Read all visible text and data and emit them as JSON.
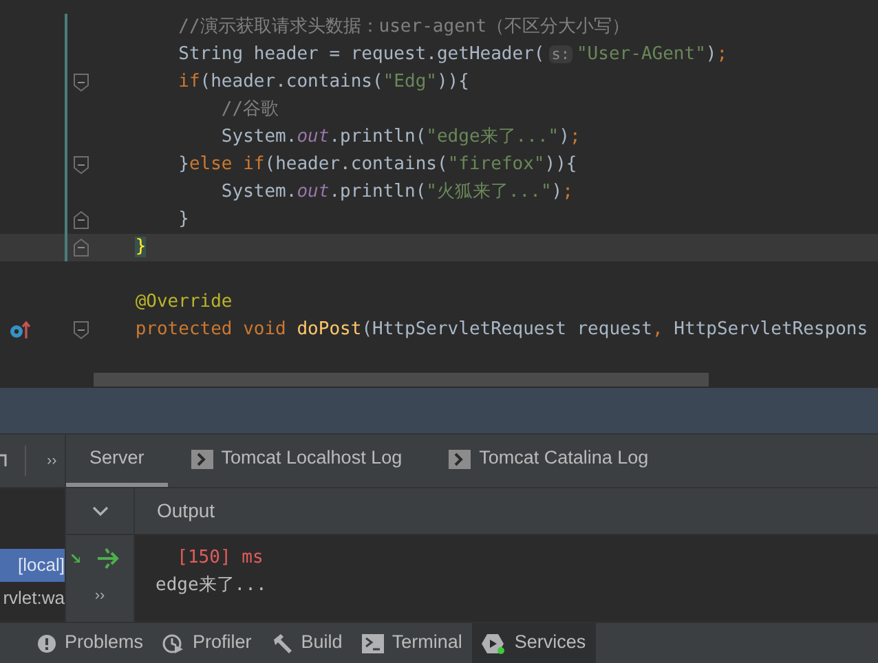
{
  "editor": {
    "lines": [
      {
        "changed": true,
        "current": false,
        "fold_open": false,
        "fold_close": false,
        "override_marker": false,
        "tokens": [
          {
            "kind": "comment",
            "text": "        //演示获取请求头数据：user-agent（不区分大小写）"
          }
        ]
      },
      {
        "changed": true,
        "current": false,
        "fold_open": false,
        "fold_close": false,
        "override_marker": false,
        "tokens": [
          {
            "kind": "plain",
            "text": "        String header = request.getHeader("
          },
          {
            "kind": "hint",
            "text": "s:"
          },
          {
            "kind": "string",
            "text": "\"User-AGent\""
          },
          {
            "kind": "plain",
            "text": ")"
          },
          {
            "kind": "keyword",
            "text": ";"
          }
        ]
      },
      {
        "changed": true,
        "current": false,
        "fold_open": true,
        "fold_close": false,
        "override_marker": false,
        "tokens": [
          {
            "kind": "keyword",
            "text": "        if"
          },
          {
            "kind": "plain",
            "text": "(header.contains("
          },
          {
            "kind": "string",
            "text": "\"Edg\""
          },
          {
            "kind": "plain",
            "text": ")){"
          }
        ]
      },
      {
        "changed": true,
        "current": false,
        "fold_open": false,
        "fold_close": false,
        "override_marker": false,
        "tokens": [
          {
            "kind": "comment",
            "text": "            //谷歌"
          }
        ]
      },
      {
        "changed": true,
        "current": false,
        "fold_open": false,
        "fold_close": false,
        "override_marker": false,
        "tokens": [
          {
            "kind": "plain",
            "text": "            System."
          },
          {
            "kind": "field",
            "text": "out"
          },
          {
            "kind": "plain",
            "text": ".println("
          },
          {
            "kind": "string",
            "text": "\"edge来了...\""
          },
          {
            "kind": "plain",
            "text": ")"
          },
          {
            "kind": "keyword",
            "text": ";"
          }
        ]
      },
      {
        "changed": true,
        "current": false,
        "fold_open": true,
        "fold_close": false,
        "override_marker": false,
        "tokens": [
          {
            "kind": "plain",
            "text": "        }"
          },
          {
            "kind": "keyword",
            "text": "else if"
          },
          {
            "kind": "plain",
            "text": "(header.contains("
          },
          {
            "kind": "string",
            "text": "\"firefox\""
          },
          {
            "kind": "plain",
            "text": ")){"
          }
        ]
      },
      {
        "changed": true,
        "current": false,
        "fold_open": false,
        "fold_close": false,
        "override_marker": false,
        "tokens": [
          {
            "kind": "plain",
            "text": "            System."
          },
          {
            "kind": "field",
            "text": "out"
          },
          {
            "kind": "plain",
            "text": ".println("
          },
          {
            "kind": "string",
            "text": "\"火狐来了...\""
          },
          {
            "kind": "plain",
            "text": ")"
          },
          {
            "kind": "keyword",
            "text": ";"
          }
        ]
      },
      {
        "changed": true,
        "current": false,
        "fold_open": false,
        "fold_close": true,
        "override_marker": false,
        "tokens": [
          {
            "kind": "plain",
            "text": "        }"
          }
        ]
      },
      {
        "changed": true,
        "current": true,
        "fold_open": false,
        "fold_close": true,
        "override_marker": false,
        "tokens": [
          {
            "kind": "brace_match",
            "text": "    }"
          }
        ]
      },
      {
        "changed": false,
        "current": false,
        "fold_open": false,
        "fold_close": false,
        "override_marker": false
      },
      {
        "changed": false,
        "current": false,
        "fold_open": false,
        "fold_close": false,
        "override_marker": false,
        "tokens": [
          {
            "kind": "annotation",
            "text": "    @Override"
          }
        ]
      },
      {
        "changed": false,
        "current": false,
        "fold_open": true,
        "fold_close": false,
        "override_marker": true,
        "tokens": [
          {
            "kind": "keyword",
            "text": "    protected void "
          },
          {
            "kind": "method",
            "text": "doPost"
          },
          {
            "kind": "plain",
            "text": "(HttpServletRequest request"
          },
          {
            "kind": "keyword",
            "text": ","
          },
          {
            "kind": "plain",
            "text": " HttpServletRespons"
          }
        ]
      },
      {
        "changed": false,
        "current": false,
        "fold_open": false,
        "fold_close": false,
        "override_marker": false
      }
    ]
  },
  "services": {
    "tabs": [
      {
        "label": "Server",
        "selected": true,
        "icon": false
      },
      {
        "label": "Tomcat Localhost Log",
        "selected": false,
        "icon": true
      },
      {
        "label": "Tomcat Catalina Log",
        "selected": false,
        "icon": true
      }
    ],
    "output_title": "Output",
    "output_lines": [
      {
        "kind": "error",
        "text": "  [150] ms"
      },
      {
        "kind": "normal",
        "text": "edge来了..."
      }
    ],
    "tree": [
      {
        "label": "[local]",
        "selected": true
      },
      {
        "label": "rvlet:wa",
        "selected": false
      }
    ]
  },
  "tool_tabs": [
    {
      "label": "Problems",
      "selected": false
    },
    {
      "label": "Profiler",
      "selected": false
    },
    {
      "label": "Build",
      "selected": false
    },
    {
      "label": "Terminal",
      "selected": false
    },
    {
      "label": "Services",
      "selected": true
    }
  ],
  "chevrons": [
    "››",
    "››"
  ]
}
